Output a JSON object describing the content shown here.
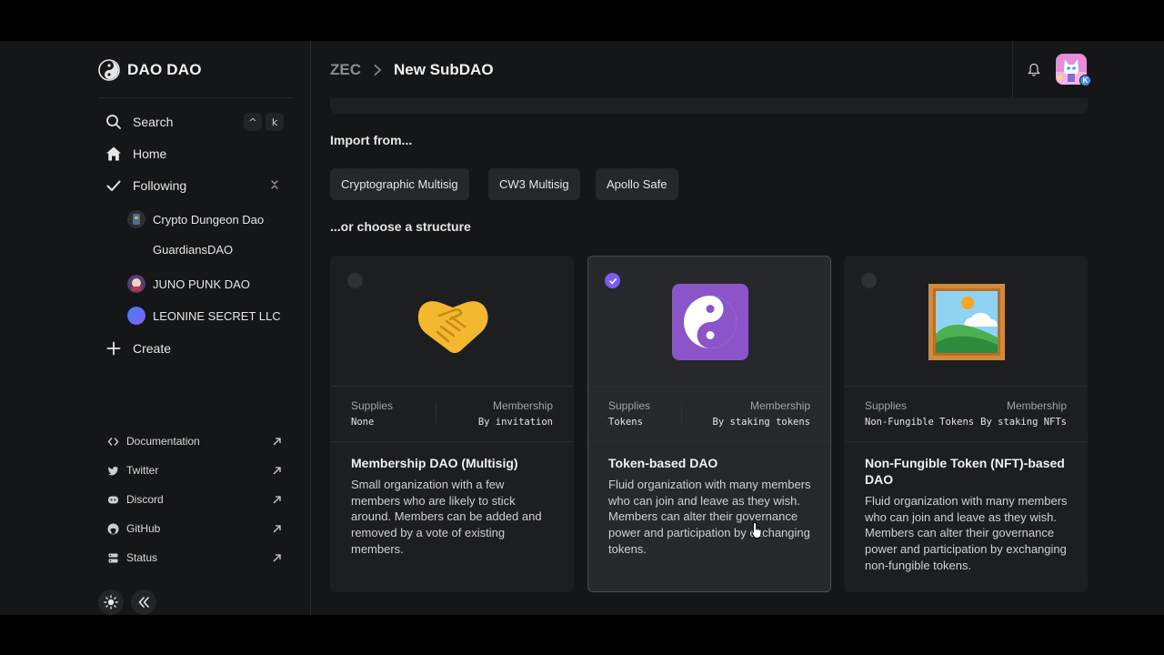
{
  "app": {
    "name": "DAO DAO"
  },
  "sidebar": {
    "search_label": "Search",
    "search_keys": [
      "^",
      "k"
    ],
    "home_label": "Home",
    "following_label": "Following",
    "following": [
      {
        "name": "Crypto Dungeon Dao"
      },
      {
        "name": "GuardiansDAO"
      },
      {
        "name": "JUNO PUNK DAO"
      },
      {
        "name": "LEONINE SECRET LLC"
      }
    ],
    "create_label": "Create",
    "links": [
      {
        "label": "Documentation",
        "icon": "code-icon"
      },
      {
        "label": "Twitter",
        "icon": "twitter-icon"
      },
      {
        "label": "Discord",
        "icon": "discord-icon"
      },
      {
        "label": "GitHub",
        "icon": "github-icon"
      },
      {
        "label": "Status",
        "icon": "server-icon"
      }
    ]
  },
  "header": {
    "breadcrumb_parent": "ZEC",
    "breadcrumb_current": "New SubDAO",
    "chain_badge": "K"
  },
  "main": {
    "import_title": "Import from...",
    "import_options": [
      "Cryptographic Multisig",
      "CW3 Multisig",
      "Apollo Safe"
    ],
    "structure_title": "...or choose a structure",
    "structures": [
      {
        "selected": false,
        "icon": "handshake-icon",
        "supplies_label": "Supplies",
        "supplies_value": "None",
        "membership_label": "Membership",
        "membership_value": "By invitation",
        "title": "Membership DAO (Multisig)",
        "description": "Small organization with a few members who are likely to stick around. Members can be added and removed by a vote of existing members."
      },
      {
        "selected": true,
        "icon": "yin-yang-icon",
        "supplies_label": "Supplies",
        "supplies_value": "Tokens",
        "membership_label": "Membership",
        "membership_value": "By staking tokens",
        "title": "Token-based DAO",
        "description": "Fluid organization with many members who can join and leave as they wish. Members can alter their governance power and participation by exchanging tokens."
      },
      {
        "selected": false,
        "icon": "framed-picture-icon",
        "supplies_label": "Supplies",
        "supplies_value": "Non-Fungible Tokens",
        "membership_label": "Membership",
        "membership_value": "By staking NFTs",
        "title": "Non-Fungible Token (NFT)-based DAO",
        "description": "Fluid organization with many members who can join and leave as they wish. Members can alter their governance power and participation by exchanging non-fungible tokens."
      }
    ]
  },
  "colors": {
    "accent": "#7a5cf0",
    "background": "#151617",
    "card": "#1c1e20"
  }
}
